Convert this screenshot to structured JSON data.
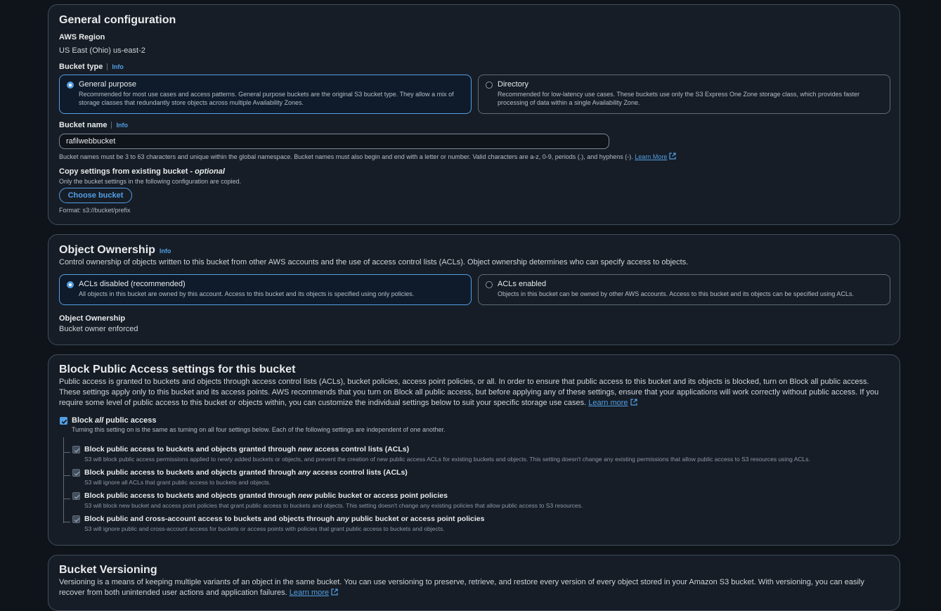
{
  "general": {
    "title": "General configuration",
    "region_label": "AWS Region",
    "region_value": "US East (Ohio) us-east-2",
    "bucket_type_label": "Bucket type",
    "info": "Info",
    "options": [
      {
        "title": "General purpose",
        "desc": "Recommended for most use cases and access patterns. General purpose buckets are the original S3 bucket type. They allow a mix of storage classes that redundantly store objects across multiple Availability Zones."
      },
      {
        "title": "Directory",
        "desc": "Recommended for low-latency use cases. These buckets use only the S3 Express One Zone storage class, which provides faster processing of data within a single Availability Zone."
      }
    ],
    "bucket_name_label": "Bucket name",
    "bucket_name_value": "rafilwebbucket",
    "bucket_name_help": "Bucket names must be 3 to 63 characters and unique within the global namespace. Bucket names must also begin and end with a letter or number. Valid characters are a-z, 0-9, periods (.), and hyphens (-).",
    "learn_more": "Learn More",
    "copy_label": "Copy settings from existing bucket - ",
    "copy_optional": "optional",
    "copy_help": "Only the bucket settings in the following configuration are copied.",
    "choose_button": "Choose bucket",
    "format_hint": "Format: s3://bucket/prefix"
  },
  "ownership": {
    "title": "Object Ownership",
    "info": "Info",
    "desc": "Control ownership of objects written to this bucket from other AWS accounts and the use of access control lists (ACLs). Object ownership determines who can specify access to objects.",
    "options": [
      {
        "title": "ACLs disabled (recommended)",
        "desc": "All objects in this bucket are owned by this account. Access to this bucket and its objects is specified using only policies."
      },
      {
        "title": "ACLs enabled",
        "desc": "Objects in this bucket can be owned by other AWS accounts. Access to this bucket and its objects can be specified using ACLs."
      }
    ],
    "field_label": "Object Ownership",
    "field_value": "Bucket owner enforced"
  },
  "block": {
    "title": "Block Public Access settings for this bucket",
    "desc": "Public access is granted to buckets and objects through access control lists (ACLs), bucket policies, access point policies, or all. In order to ensure that public access to this bucket and its objects is blocked, turn on Block all public access. These settings apply only to this bucket and its access points. AWS recommends that you turn on Block all public access, but before applying any of these settings, ensure that your applications will work correctly without public access. If you require some level of public access to this bucket or objects within, you can customize the individual settings below to suit your specific storage use cases.",
    "learn_more": "Learn more",
    "all_pre": "Block ",
    "all_em": "all",
    "all_post": " public access",
    "all_desc": "Turning this setting on is the same as turning on all four settings below. Each of the following settings are independent of one another.",
    "items": [
      {
        "pre": "Block public access to buckets and objects granted through ",
        "em": "new",
        "post": " access control lists (ACLs)",
        "desc": "S3 will block public access permissions applied to newly added buckets or objects, and prevent the creation of new public access ACLs for existing buckets and objects. This setting doesn't change any existing permissions that allow public access to S3 resources using ACLs."
      },
      {
        "pre": "Block public access to buckets and objects granted through ",
        "em": "any",
        "post": " access control lists (ACLs)",
        "desc": "S3 will ignore all ACLs that grant public access to buckets and objects."
      },
      {
        "pre": "Block public access to buckets and objects granted through ",
        "em": "new",
        "post": " public bucket or access point policies",
        "desc": "S3 will block new bucket and access point policies that grant public access to buckets and objects. This setting doesn't change any existing policies that allow public access to S3 resources."
      },
      {
        "pre": "Block public and cross-account access to buckets and objects through ",
        "em": "any",
        "post": " public bucket or access point policies",
        "desc": "S3 will ignore public and cross-account access for buckets or access points with policies that grant public access to buckets and objects."
      }
    ]
  },
  "versioning": {
    "title": "Bucket Versioning",
    "desc": "Versioning is a means of keeping multiple variants of an object in the same bucket. You can use versioning to preserve, retrieve, and restore every version of every object stored in your Amazon S3 bucket. With versioning, you can easily recover from both unintended user actions and application failures.",
    "learn_more": "Learn more"
  },
  "colors": {
    "background": "#0f141a",
    "panel": "#161d26",
    "accent": "#539fe5",
    "border": "#414d5c"
  }
}
